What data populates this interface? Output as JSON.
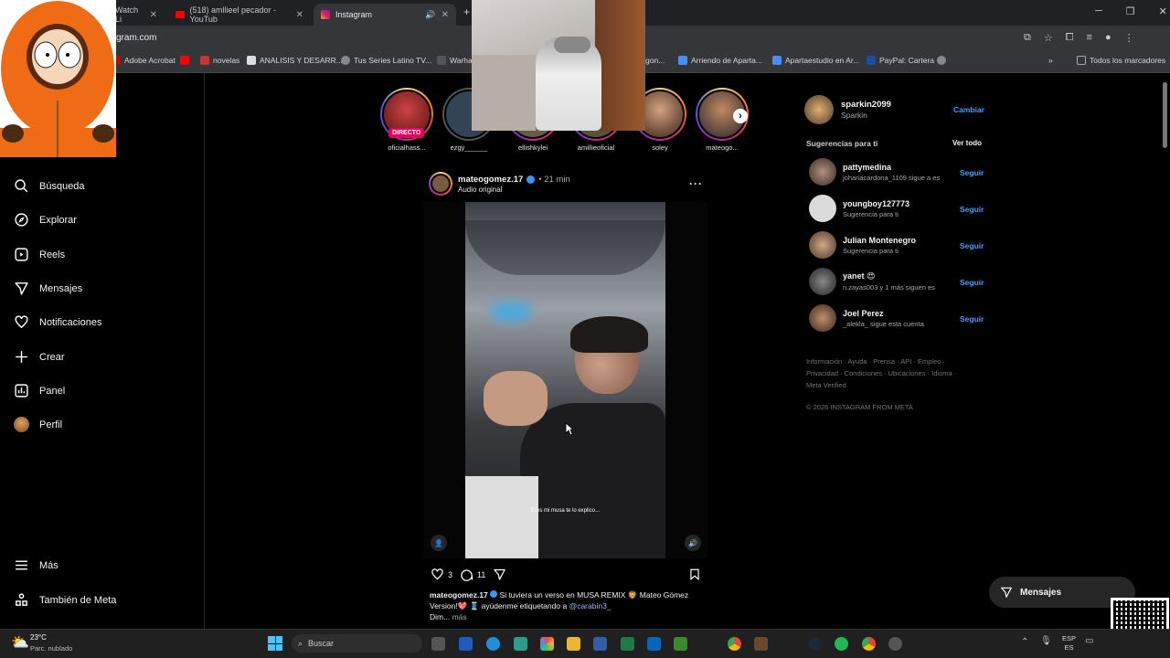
{
  "browser": {
    "tabs": [
      {
        "title": "Watch Li"
      },
      {
        "title": "(518) amllieel pecador - YouTub"
      },
      {
        "title": "Instagram"
      }
    ],
    "url": "gram.com",
    "bookmarks": [
      "Adobe Acrobat",
      "novelas",
      "ANALISIS Y DESARR...",
      "Tus Series Latino TV...",
      "Warhan",
      "gon...",
      "Arriendo de Aparta...",
      "Apartaestudio en Ar...",
      "PayPal: Cartera"
    ],
    "all_bookmarks": "Todos los marcadores"
  },
  "sidebar": {
    "items": [
      {
        "label": "Búsqueda",
        "icon": "search-icon"
      },
      {
        "label": "Explorar",
        "icon": "compass-icon"
      },
      {
        "label": "Reels",
        "icon": "reels-icon"
      },
      {
        "label": "Mensajes",
        "icon": "send-icon"
      },
      {
        "label": "Notificaciones",
        "icon": "heart-icon"
      },
      {
        "label": "Crear",
        "icon": "plus-icon"
      },
      {
        "label": "Panel",
        "icon": "chart-icon"
      },
      {
        "label": "Perfil",
        "icon": "avatar-icon"
      }
    ],
    "more": "Más",
    "meta": "También de Meta"
  },
  "stories": [
    {
      "name": "oficialhass...",
      "live": "DIRECTO"
    },
    {
      "name": "ezgy______"
    },
    {
      "name": "ellishkylei"
    },
    {
      "name": "amillieoficial"
    },
    {
      "name": "soley"
    },
    {
      "name": "mateogo..."
    }
  ],
  "post": {
    "user": "mateogomez.17",
    "time": "• 21 min",
    "audio": "Audio original",
    "video_caption": "Eres mi musa te lo explico...",
    "likes": "3",
    "comments": "11",
    "caption_user": "mateogomez.17",
    "caption": "Si tuviera un verso en MUSA REMIX 🦁 Mateo Gómez Version!💖 🧵 ayúdenme etiquetando a",
    "mention": "@carabin3_",
    "caption_end": "Dim...",
    "more": "más"
  },
  "account": {
    "user": "sparkin2099",
    "name": "Sparkin",
    "switch": "Cambiar"
  },
  "suggestions": {
    "title": "Sugerencias para ti",
    "see_all": "Ver todo",
    "follow_label": "Seguir",
    "items": [
      {
        "name": "pattymedina",
        "sub": "johanacardona_1109 sigue a es"
      },
      {
        "name": "youngboy127773",
        "sub": "Sugerencia para ti"
      },
      {
        "name": "Julian Montenegro",
        "sub": "Sugerencia para ti"
      },
      {
        "name": "yanet 😍",
        "sub": "n.zayas003 y 1 más siguen es"
      },
      {
        "name": "Joel Perez",
        "sub": "_alekla_ sigue esta cuenta"
      }
    ]
  },
  "footer": {
    "line1": "Información · Ayuda · Prensa · API · Empleo ·",
    "line2": "Privacidad · Condiciones · Ubicaciones · Idioma ·",
    "line3": "Meta Verified",
    "copyright": "© 2026 INSTAGRAM FROM META"
  },
  "messages_button": "Mensajes",
  "taskbar": {
    "temp": "23°C",
    "weather": "Parc. nublado",
    "search": "Buscar",
    "lang1": "ESP",
    "lang2": "ES"
  }
}
